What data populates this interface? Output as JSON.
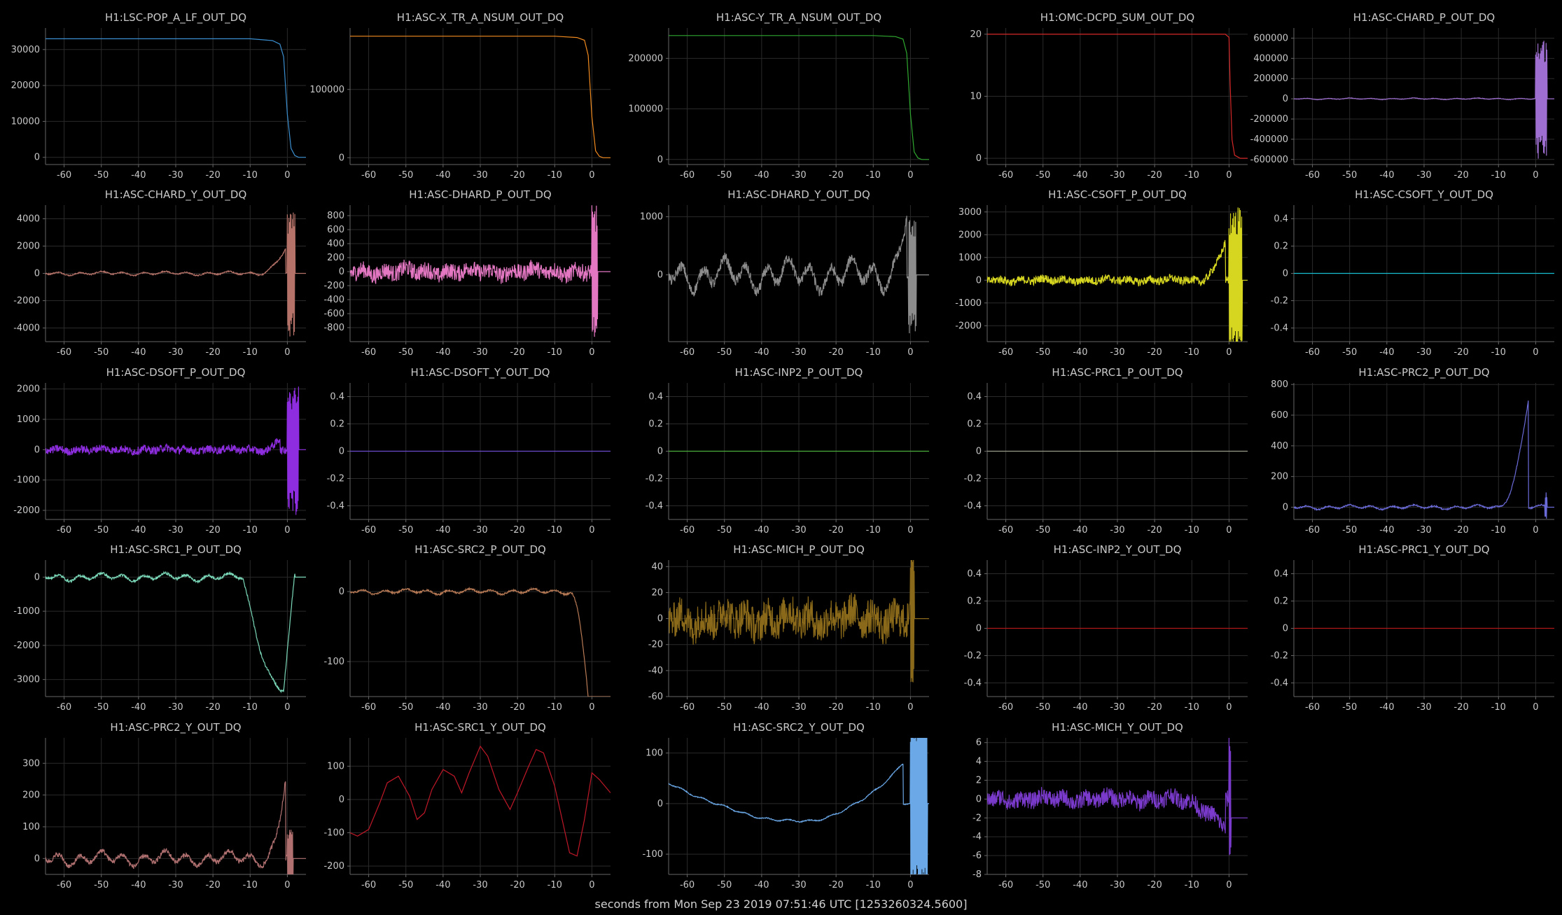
{
  "figure": {
    "xlabel": "seconds from Mon Sep 23 2019 07:51:46 UTC [1253260324.5600]"
  },
  "chart_data": [
    {
      "type": "line",
      "title": "H1:LSC-POP_A_LF_OUT_DQ",
      "color": "#3b8fd0",
      "xlim": [
        -65,
        5
      ],
      "ylim": [
        -2000,
        36000
      ],
      "yticks": [
        0,
        10000,
        20000,
        30000
      ],
      "xticks": [
        -60,
        -50,
        -40,
        -30,
        -20,
        -10,
        0
      ],
      "grid": true,
      "style": "step_drop",
      "series": [
        {
          "x": [
            -65,
            -10,
            -4,
            -2,
            -1,
            0,
            1,
            2,
            3,
            5
          ],
          "y": [
            33000,
            33000,
            32500,
            31500,
            28000,
            12000,
            2500,
            500,
            0,
            0
          ]
        }
      ]
    },
    {
      "type": "line",
      "title": "H1:ASC-X_TR_A_NSUM_OUT_DQ",
      "color": "#f08a1e",
      "xlim": [
        -65,
        5
      ],
      "ylim": [
        -10000,
        190000
      ],
      "yticks": [
        0,
        100000
      ],
      "xticks": [
        -60,
        -50,
        -40,
        -30,
        -20,
        -10,
        0
      ],
      "grid": true,
      "style": "step_drop",
      "series": [
        {
          "x": [
            -65,
            -10,
            -4,
            -2,
            -1,
            0,
            1,
            2,
            3,
            5
          ],
          "y": [
            178000,
            178000,
            176000,
            172000,
            150000,
            60000,
            10000,
            2000,
            0,
            0
          ]
        }
      ]
    },
    {
      "type": "line",
      "title": "H1:ASC-Y_TR_A_NSUM_OUT_DQ",
      "color": "#2fa82f",
      "xlim": [
        -65,
        5
      ],
      "ylim": [
        -10000,
        260000
      ],
      "yticks": [
        0,
        100000,
        200000
      ],
      "xticks": [
        -60,
        -50,
        -40,
        -30,
        -20,
        -10,
        0
      ],
      "grid": true,
      "style": "step_drop",
      "series": [
        {
          "x": [
            -65,
            -10,
            -4,
            -2,
            -1,
            0,
            1,
            2,
            3,
            5
          ],
          "y": [
            245000,
            245000,
            243000,
            238000,
            210000,
            90000,
            15000,
            3000,
            0,
            0
          ]
        }
      ]
    },
    {
      "type": "line",
      "title": "H1:OMC-DCPD_SUM_OUT_DQ",
      "color": "#d62828",
      "xlim": [
        -65,
        5
      ],
      "ylim": [
        -1,
        21
      ],
      "yticks": [
        0,
        10,
        20
      ],
      "xticks": [
        -60,
        -50,
        -40,
        -30,
        -20,
        -10,
        0
      ],
      "grid": true,
      "style": "step_drop",
      "series": [
        {
          "x": [
            -65,
            -1,
            0,
            0.3,
            0.8,
            1.5,
            3,
            5
          ],
          "y": [
            20,
            20,
            19.5,
            12,
            3,
            0.5,
            0,
            0
          ]
        }
      ]
    },
    {
      "type": "line",
      "title": "H1:ASC-CHARD_P_OUT_DQ",
      "color": "#9e6fd0",
      "xlim": [
        -65,
        5
      ],
      "ylim": [
        -650000,
        700000
      ],
      "yticks": [
        -600000,
        -400000,
        -200000,
        0,
        200000,
        400000,
        600000
      ],
      "xticks": [
        -60,
        -50,
        -40,
        -30,
        -20,
        -10,
        0
      ],
      "grid": true,
      "style": "burst",
      "amp": 8000,
      "burst": {
        "x0": 0,
        "x1": 3,
        "amp": 600000
      },
      "end": 0
    },
    {
      "type": "line",
      "title": "H1:ASC-CHARD_Y_OUT_DQ",
      "color": "#b57268",
      "xlim": [
        -65,
        5
      ],
      "ylim": [
        -5000,
        5000
      ],
      "yticks": [
        -4000,
        -2000,
        0,
        2000,
        4000
      ],
      "xticks": [
        -60,
        -50,
        -40,
        -30,
        -20,
        -10,
        0
      ],
      "grid": true,
      "style": "wave_ramp",
      "amp": 150,
      "ramp": {
        "x0": -8,
        "x1": -0.5,
        "y1": 1800
      },
      "burst": {
        "x0": 0,
        "x1": 2,
        "amp": 4800
      },
      "end": 0
    },
    {
      "type": "line",
      "title": "H1:ASC-DHARD_P_OUT_DQ",
      "color": "#e377c2",
      "xlim": [
        -65,
        5
      ],
      "ylim": [
        -1000,
        950
      ],
      "yticks": [
        -800,
        -600,
        -400,
        -200,
        0,
        200,
        400,
        600,
        800
      ],
      "xticks": [
        -60,
        -50,
        -40,
        -30,
        -20,
        -10,
        0
      ],
      "grid": true,
      "style": "noisy",
      "amp": 120,
      "burst": {
        "x0": 0,
        "x1": 1.5,
        "amp": 950
      },
      "end": 0
    },
    {
      "type": "line",
      "title": "H1:ASC-DHARD_Y_OUT_DQ",
      "color": "#8c8c8c",
      "xlim": [
        -65,
        5
      ],
      "ylim": [
        -1150,
        1200
      ],
      "yticks": [
        0,
        1000
      ],
      "xticks": [
        -60,
        -50,
        -40,
        -30,
        -20,
        -10,
        0
      ],
      "grid": true,
      "style": "wave_ramp",
      "amp": 300,
      "ramp": {
        "x0": -6,
        "x1": -1,
        "y1": 1100
      },
      "burst": {
        "x0": -0.5,
        "x1": 1.5,
        "amp": 1100
      },
      "end": 0
    },
    {
      "type": "line",
      "title": "H1:ASC-CSOFT_P_OUT_DQ",
      "color": "#d6d620",
      "xlim": [
        -65,
        5
      ],
      "ylim": [
        -2700,
        3300
      ],
      "yticks": [
        -2000,
        -1000,
        0,
        1000,
        2000,
        3000
      ],
      "xticks": [
        -60,
        -50,
        -40,
        -30,
        -20,
        -10,
        0
      ],
      "grid": true,
      "style": "noisy_ramp",
      "amp": 180,
      "ramp": {
        "x0": -8,
        "x1": -1,
        "y1": 1700
      },
      "burst": {
        "x0": 0,
        "x1": 3.5,
        "amp": 3200
      },
      "end": 0
    },
    {
      "type": "line",
      "title": "H1:ASC-CSOFT_Y_OUT_DQ",
      "color": "#17becf",
      "xlim": [
        -65,
        5
      ],
      "ylim": [
        -0.5,
        0.5
      ],
      "yticks": [
        -0.4,
        -0.2,
        0,
        0.2,
        0.4
      ],
      "xticks": [
        -60,
        -50,
        -40,
        -30,
        -20,
        -10,
        0
      ],
      "grid": true,
      "style": "flat",
      "series": [
        {
          "x": [
            -65,
            5
          ],
          "y": [
            0,
            0
          ]
        }
      ]
    },
    {
      "type": "line",
      "title": "H1:ASC-DSOFT_P_OUT_DQ",
      "color": "#8e2de0",
      "xlim": [
        -65,
        5
      ],
      "ylim": [
        -2300,
        2200
      ],
      "yticks": [
        -2000,
        -1000,
        0,
        1000,
        2000
      ],
      "xticks": [
        -60,
        -50,
        -40,
        -30,
        -20,
        -10,
        0
      ],
      "grid": true,
      "style": "noisy_ramp",
      "amp": 130,
      "ramp": {
        "x0": -6,
        "x1": -2,
        "y1": 400
      },
      "burst": {
        "x0": 0,
        "x1": 3,
        "amp": 2200
      },
      "end": 0
    },
    {
      "type": "line",
      "title": "H1:ASC-DSOFT_Y_OUT_DQ",
      "color": "#6a4bd0",
      "xlim": [
        -65,
        5
      ],
      "ylim": [
        -0.5,
        0.5
      ],
      "yticks": [
        -0.4,
        -0.2,
        0,
        0.2,
        0.4
      ],
      "xticks": [
        -60,
        -50,
        -40,
        -30,
        -20,
        -10,
        0
      ],
      "grid": true,
      "style": "flat",
      "series": [
        {
          "x": [
            -65,
            5
          ],
          "y": [
            0,
            0
          ]
        }
      ]
    },
    {
      "type": "line",
      "title": "H1:ASC-INP2_P_OUT_DQ",
      "color": "#4caf3c",
      "xlim": [
        -65,
        5
      ],
      "ylim": [
        -0.5,
        0.5
      ],
      "yticks": [
        -0.4,
        -0.2,
        0,
        0.2,
        0.4
      ],
      "xticks": [
        -60,
        -50,
        -40,
        -30,
        -20,
        -10,
        0
      ],
      "grid": true,
      "style": "flat",
      "series": [
        {
          "x": [
            -65,
            5
          ],
          "y": [
            0,
            0
          ]
        }
      ]
    },
    {
      "type": "line",
      "title": "H1:ASC-PRC1_P_OUT_DQ",
      "color": "#9a9a8a",
      "xlim": [
        -65,
        5
      ],
      "ylim": [
        -0.5,
        0.5
      ],
      "yticks": [
        -0.4,
        -0.2,
        0,
        0.2,
        0.4
      ],
      "xticks": [
        -60,
        -50,
        -40,
        -30,
        -20,
        -10,
        0
      ],
      "grid": true,
      "style": "flat",
      "series": [
        {
          "x": [
            -65,
            5
          ],
          "y": [
            0,
            0
          ]
        }
      ]
    },
    {
      "type": "line",
      "title": "H1:ASC-PRC2_P_OUT_DQ",
      "color": "#6a6ad8",
      "xlim": [
        -65,
        5
      ],
      "ylim": [
        -80,
        810
      ],
      "yticks": [
        0,
        200,
        400,
        600,
        800
      ],
      "xticks": [
        -60,
        -50,
        -40,
        -30,
        -20,
        -10,
        0
      ],
      "grid": true,
      "style": "wave_ramp",
      "amp": 15,
      "ramp": {
        "x0": -10,
        "x1": -2,
        "y1": 700
      },
      "burst": {
        "x0": 2.5,
        "x1": 3,
        "amp": 100
      },
      "end": 0
    },
    {
      "type": "line",
      "title": "H1:ASC-SRC1_P_OUT_DQ",
      "color": "#7ad8b8",
      "xlim": [
        -65,
        5
      ],
      "ylim": [
        -3500,
        500
      ],
      "yticks": [
        -3000,
        -2000,
        -1000,
        0
      ],
      "xticks": [
        -60,
        -50,
        -40,
        -30,
        -20,
        -10,
        0
      ],
      "grid": true,
      "style": "dip",
      "amp": 120,
      "dip": {
        "x0": -12,
        "xmin": -1,
        "ymin": -3300,
        "x1": 2
      },
      "end": 0
    },
    {
      "type": "line",
      "title": "H1:ASC-SRC2_P_OUT_DQ",
      "color": "#b87a55",
      "xlim": [
        -65,
        5
      ],
      "ylim": [
        -150,
        45
      ],
      "yticks": [
        -100,
        0
      ],
      "xticks": [
        -60,
        -50,
        -40,
        -30,
        -20,
        -10,
        0
      ],
      "grid": true,
      "style": "wave_fall",
      "amp": 4,
      "fall": {
        "x0": -6,
        "x1": -1,
        "y1": -150
      },
      "end": 0
    },
    {
      "type": "line",
      "title": "H1:ASC-MICH_P_OUT_DQ",
      "color": "#8a6a1a",
      "xlim": [
        -65,
        5
      ],
      "ylim": [
        -60,
        45
      ],
      "yticks": [
        -60,
        -40,
        -20,
        0,
        20,
        40
      ],
      "xticks": [
        -60,
        -50,
        -40,
        -30,
        -20,
        -10,
        0
      ],
      "grid": true,
      "style": "noisy",
      "amp": 14,
      "burst": {
        "x0": 0,
        "x1": 1,
        "amp": 60
      },
      "end": 0
    },
    {
      "type": "line",
      "title": "H1:ASC-INP2_Y_OUT_DQ",
      "color": "#b01818",
      "xlim": [
        -65,
        5
      ],
      "ylim": [
        -0.5,
        0.5
      ],
      "yticks": [
        -0.4,
        -0.2,
        0,
        0.2,
        0.4
      ],
      "xticks": [
        -60,
        -50,
        -40,
        -30,
        -20,
        -10,
        0
      ],
      "grid": true,
      "style": "flat",
      "series": [
        {
          "x": [
            -65,
            5
          ],
          "y": [
            0,
            0
          ]
        }
      ]
    },
    {
      "type": "line",
      "title": "H1:ASC-PRC1_Y_OUT_DQ",
      "color": "#b01818",
      "xlim": [
        -65,
        5
      ],
      "ylim": [
        -0.5,
        0.5
      ],
      "yticks": [
        -0.4,
        -0.2,
        0,
        0.2,
        0.4
      ],
      "xticks": [
        -60,
        -50,
        -40,
        -30,
        -20,
        -10,
        0
      ],
      "grid": true,
      "style": "flat",
      "series": [
        {
          "x": [
            -65,
            5
          ],
          "y": [
            0,
            0
          ]
        }
      ]
    },
    {
      "type": "line",
      "title": "H1:ASC-PRC2_Y_OUT_DQ",
      "color": "#b07070",
      "xlim": [
        -65,
        5
      ],
      "ylim": [
        -50,
        380
      ],
      "yticks": [
        0,
        100,
        200,
        300
      ],
      "xticks": [
        -60,
        -50,
        -40,
        -30,
        -20,
        -10,
        0
      ],
      "grid": true,
      "style": "wave_ramp",
      "amp": 25,
      "ramp": {
        "x0": -6,
        "x1": -0.5,
        "y1": 250
      },
      "burst": {
        "x0": 0,
        "x1": 1.5,
        "amp": 100
      },
      "end": 0
    },
    {
      "type": "line",
      "title": "H1:ASC-SRC1_Y_OUT_DQ",
      "color": "#c01828",
      "xlim": [
        -65,
        5
      ],
      "ylim": [
        -225,
        185
      ],
      "yticks": [
        -200,
        -100,
        0,
        100
      ],
      "xticks": [
        -60,
        -50,
        -40,
        -30,
        -20,
        -10,
        0
      ],
      "grid": true,
      "style": "smooth",
      "series": [
        {
          "x": [
            -65,
            -63,
            -60,
            -57,
            -55,
            -52,
            -49,
            -47,
            -45,
            -43,
            -40,
            -37,
            -35,
            -33,
            -30,
            -28,
            -25,
            -22,
            -20,
            -17,
            -15,
            -13,
            -10,
            -8,
            -6,
            -4,
            -2,
            0,
            2,
            5
          ],
          "y": [
            -100,
            -110,
            -90,
            -10,
            50,
            70,
            10,
            -60,
            -40,
            30,
            90,
            70,
            20,
            80,
            160,
            130,
            30,
            -30,
            20,
            100,
            150,
            140,
            40,
            -60,
            -160,
            -170,
            -60,
            80,
            60,
            20
          ]
        }
      ]
    },
    {
      "type": "line",
      "title": "H1:ASC-SRC2_Y_OUT_DQ",
      "color": "#6aa8e8",
      "xlim": [
        -65,
        5
      ],
      "ylim": [
        -140,
        130
      ],
      "yticks": [
        -100,
        0,
        100
      ],
      "xticks": [
        -60,
        -50,
        -40,
        -30,
        -20,
        -10,
        0
      ],
      "grid": true,
      "style": "bowl",
      "amp": 3,
      "bowl": {
        "y0": 40,
        "ymin": -35,
        "xmin": -30,
        "y1": 80,
        "x1": -2
      },
      "burst": {
        "x0": 0,
        "x1": 4.5,
        "amp": 200
      },
      "end": 0
    },
    {
      "type": "line",
      "title": "H1:ASC-MICH_Y_OUT_DQ",
      "color": "#7a3acc",
      "xlim": [
        -65,
        5
      ],
      "ylim": [
        -8,
        6.5
      ],
      "yticks": [
        -8,
        -6,
        -4,
        -2,
        0,
        2,
        4,
        6
      ],
      "xticks": [
        -60,
        -50,
        -40,
        -30,
        -20,
        -10,
        0
      ],
      "grid": true,
      "style": "noisy_ramp",
      "amp": 0.9,
      "ramp": {
        "x0": -15,
        "x1": -1,
        "y1": -3
      },
      "burst": {
        "x0": 0,
        "x1": 0.5,
        "amp": 7
      },
      "end": -2
    }
  ]
}
